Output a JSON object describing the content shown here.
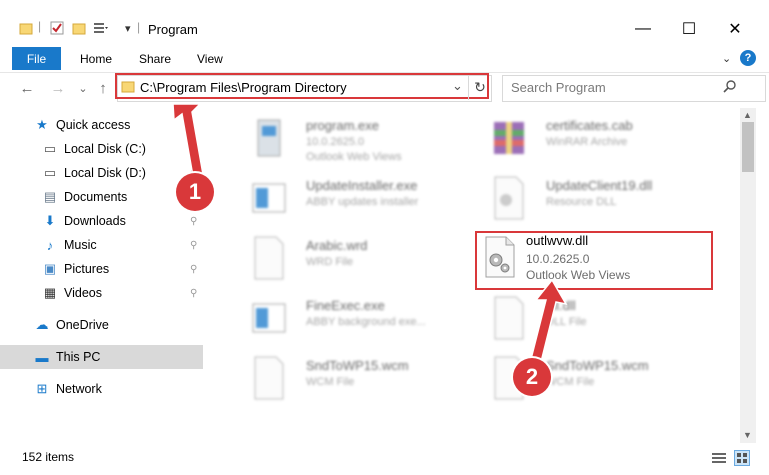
{
  "window": {
    "title": "Program",
    "minimize_glyph": "—",
    "maximize_glyph": "☐",
    "close_glyph": "✕"
  },
  "ribbon": {
    "file": "File",
    "home": "Home",
    "share": "Share",
    "view": "View",
    "help_glyph": "?"
  },
  "nav": {
    "back_glyph": "←",
    "forward_glyph": "→",
    "recent_glyph": "⌄",
    "up_glyph": "↑",
    "address": "C:\\Program Files\\Program Directory",
    "refresh_glyph": "↻",
    "dropdown_glyph": "⌄",
    "search_placeholder": "Search Program",
    "search_glyph": "⚲"
  },
  "sidebar": {
    "items": [
      {
        "label": "Quick access",
        "icon": "star-icon",
        "glyph": "★",
        "color": "#1979ca",
        "pinned": false
      },
      {
        "label": "Local Disk (C:)",
        "icon": "drive-icon",
        "glyph": "▭",
        "color": "#555",
        "pinned": true
      },
      {
        "label": "Local Disk (D:)",
        "icon": "drive-icon",
        "glyph": "▭",
        "color": "#555",
        "pinned": true
      },
      {
        "label": "Documents",
        "icon": "documents-icon",
        "glyph": "▤",
        "color": "#6b7b8c",
        "pinned": true
      },
      {
        "label": "Downloads",
        "icon": "download-icon",
        "glyph": "⬇",
        "color": "#1979ca",
        "pinned": true
      },
      {
        "label": "Music",
        "icon": "music-icon",
        "glyph": "♪",
        "color": "#1979ca",
        "pinned": true
      },
      {
        "label": "Pictures",
        "icon": "pictures-icon",
        "glyph": "▣",
        "color": "#4a8ac7",
        "pinned": true
      },
      {
        "label": "Videos",
        "icon": "videos-icon",
        "glyph": "▦",
        "color": "#333",
        "pinned": true
      },
      {
        "label": "OneDrive",
        "icon": "cloud-icon",
        "glyph": "☁",
        "color": "#1979ca",
        "pinned": false
      },
      {
        "label": "This PC",
        "icon": "computer-icon",
        "glyph": "▬",
        "color": "#1979ca",
        "pinned": false,
        "selected": true
      },
      {
        "label": "Network",
        "icon": "network-icon",
        "glyph": "⊞",
        "color": "#1979ca",
        "pinned": false
      }
    ],
    "pin_glyph": "📌"
  },
  "files": [
    {
      "name": "program.exe",
      "line1": "10.0.2625.0",
      "line2": "Outlook Web Views",
      "icon": "installer-icon"
    },
    {
      "name": "certificates.cab",
      "line1": "WinRAR Archive",
      "line2": "",
      "icon": "archive-icon"
    },
    {
      "name": "UpdateInstaller.exe",
      "line1": "ABBY updates installer",
      "line2": "",
      "icon": "app-icon"
    },
    {
      "name": "UpdateClient19.dll",
      "line1": "Resource DLL",
      "line2": "",
      "icon": "dll-icon"
    },
    {
      "name": "Arabic.wrd",
      "line1": "WRD File",
      "line2": "",
      "icon": "blank-file-icon"
    },
    {
      "name": "FineExec.exe",
      "line1": "ABBY background exe...",
      "line2": "",
      "icon": "app-icon"
    },
    {
      "name": "dll.dll",
      "line1": "DLL File",
      "line2": "",
      "icon": "blank-file-icon"
    },
    {
      "name": "SndToWP15.wcm",
      "line1": "WCM File",
      "line2": "",
      "icon": "blank-file-icon"
    },
    {
      "name": "SndToWP15.wcm",
      "line1": "WCM File",
      "line2": "",
      "icon": "blank-file-icon"
    }
  ],
  "target_file": {
    "name": "outlwvw.dll",
    "version": "10.0.2625.0",
    "description": "Outlook Web Views",
    "icon": "dll-gear-icon"
  },
  "callouts": {
    "one": "1",
    "two": "2"
  },
  "status": {
    "items": "152 items"
  },
  "colors": {
    "accent": "#1979ca",
    "highlight": "#d9383a"
  }
}
